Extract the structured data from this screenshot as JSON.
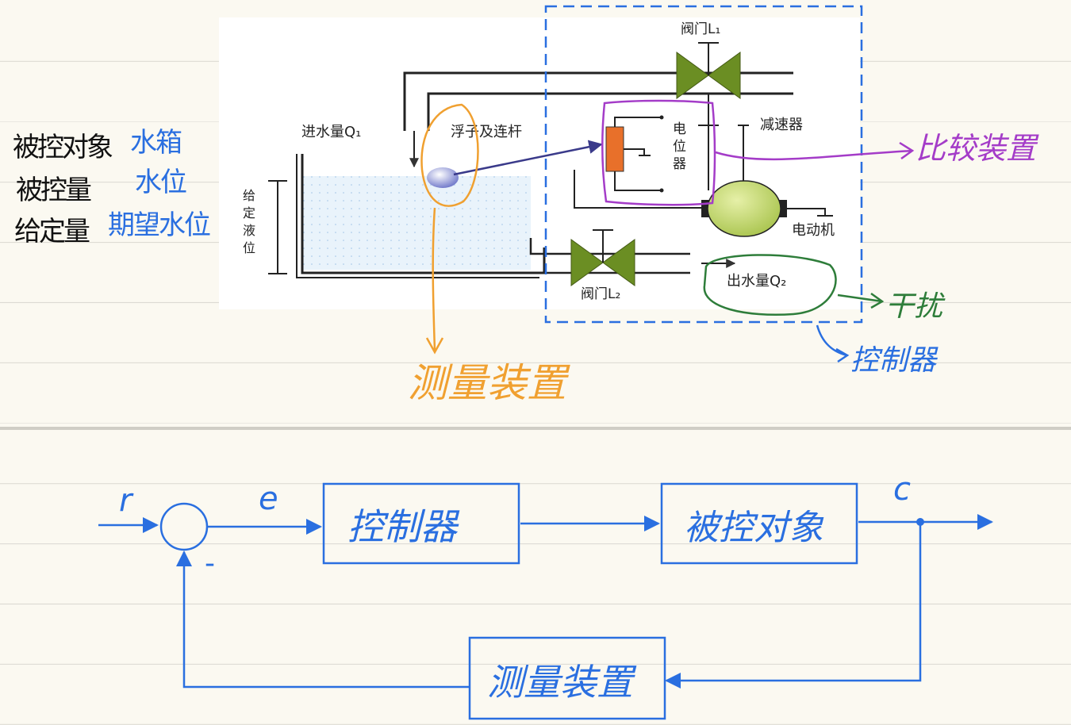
{
  "notes": {
    "controlled_object_label": "被控对象",
    "controlled_object_value": "水箱",
    "controlled_variable_label": "被控量",
    "controlled_variable_value": "水位",
    "setpoint_label": "给定量",
    "setpoint_value": "期望水位"
  },
  "diagram": {
    "valve_l1": "阀门L₁",
    "inflow": "进水量Q₁",
    "float_link": "浮子及连杆",
    "potentiometer": [
      "电",
      "位",
      "器"
    ],
    "reducer": "减速器",
    "motor": "电动机",
    "given_level": [
      "给",
      "定",
      "液",
      "位"
    ],
    "valve_l2": "阀门L₂",
    "outflow": "出水量Q₂"
  },
  "annotations": {
    "comparison_device": "比较装置",
    "measuring_device": "测量装置",
    "disturbance": "干扰",
    "controller": "控制器"
  },
  "block_diagram": {
    "input": "r",
    "error": "e",
    "output": "c",
    "minus": "-",
    "controller_block": "控制器",
    "plant_block": "被控对象",
    "feedback_block": "测量装置"
  },
  "colors": {
    "blue": "#2a6fe0",
    "orange": "#f0a030",
    "purple": "#a43cc8",
    "green": "#2e7d3a",
    "valve": "#6b8e23",
    "motor": "#c5d86d",
    "resistor": "#e8702a",
    "arrow": "#3a3a8a"
  }
}
